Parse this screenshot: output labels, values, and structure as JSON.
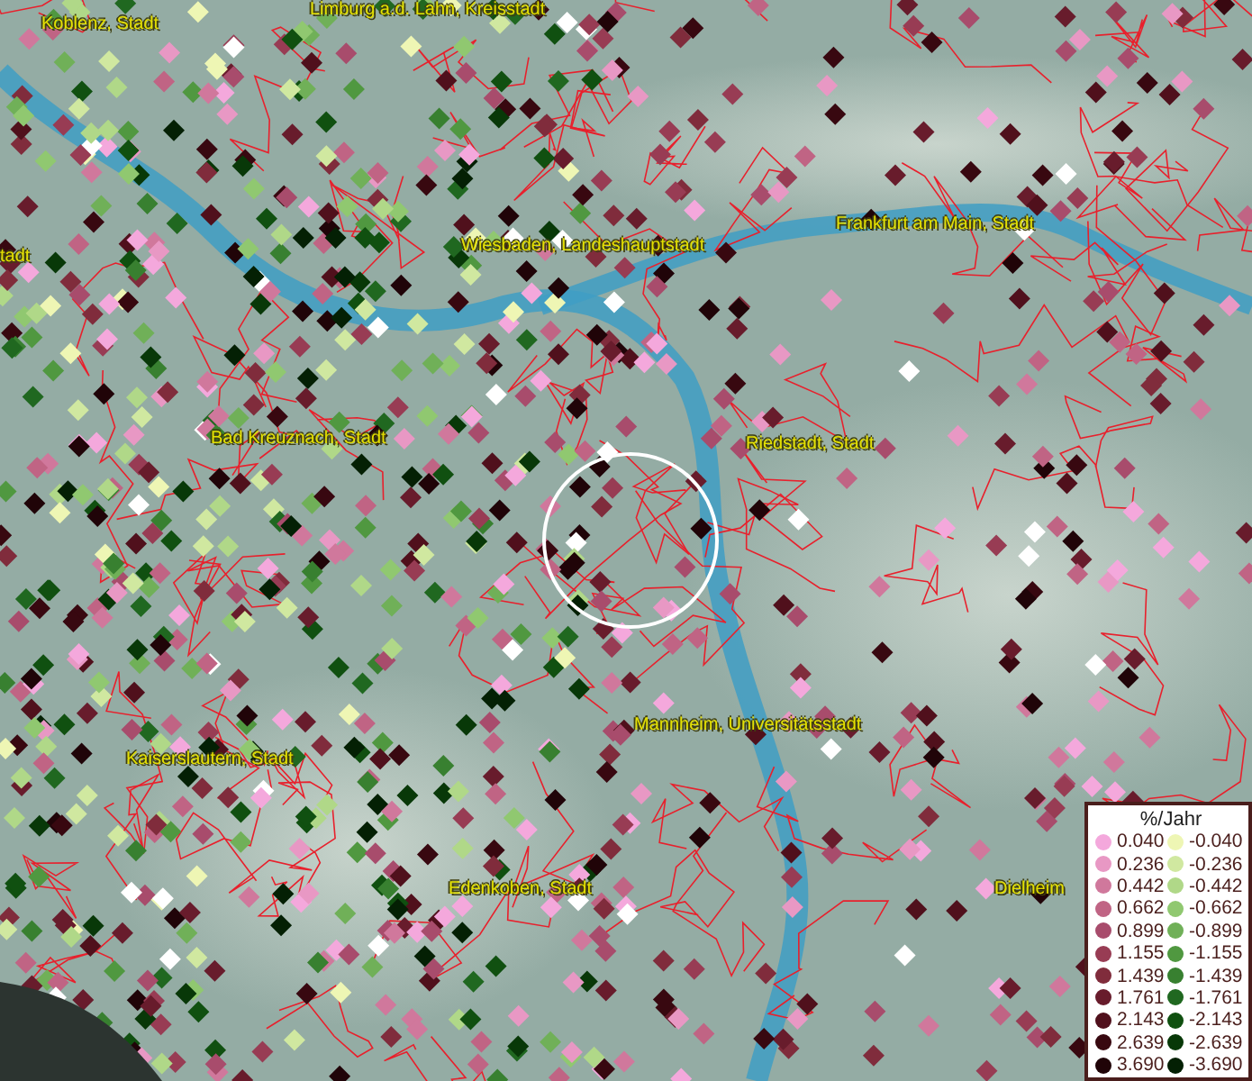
{
  "map": {
    "place_labels": [
      "Limburg a.d. Lahn, Kreisstadt",
      "Koblenz, Stadt",
      "tadt",
      "Wiesbaden, Landeshauptstadt",
      "Frankfurt am Main, Stadt",
      "Bad Kreuznach, Stadt",
      "Riedstadt, Stadt",
      "Mannheim, Universitätsstadt",
      "Kaiserslautern, Stadt",
      "Edenkoben, Stadt",
      "Dielheim"
    ]
  },
  "legend": {
    "title": "%/Jahr",
    "items": [
      {
        "label": "0.040",
        "color": "#f4a8dc"
      },
      {
        "label": "-0.040",
        "color": "#eef6b4"
      },
      {
        "label": "0.236",
        "color": "#e898c4"
      },
      {
        "label": "-0.236",
        "color": "#d0e8a0"
      },
      {
        "label": "0.442",
        "color": "#d0789c"
      },
      {
        "label": "-0.442",
        "color": "#b0d888"
      },
      {
        "label": "0.662",
        "color": "#c06484"
      },
      {
        "label": "-0.662",
        "color": "#90c870"
      },
      {
        "label": "0.899",
        "color": "#a84c6c"
      },
      {
        "label": "-0.899",
        "color": "#70b058"
      },
      {
        "label": "1.155",
        "color": "#983c54"
      },
      {
        "label": "-1.155",
        "color": "#509840"
      },
      {
        "label": "1.439",
        "color": "#802c3c"
      },
      {
        "label": "-1.439",
        "color": "#388030"
      },
      {
        "label": "1.761",
        "color": "#681c2c"
      },
      {
        "label": "-1.761",
        "color": "#206820"
      },
      {
        "label": "2.143",
        "color": "#50101c"
      },
      {
        "label": "-2.143",
        "color": "#105010"
      },
      {
        "label": "2.639",
        "color": "#380810"
      },
      {
        "label": "-2.639",
        "color": "#083808"
      },
      {
        "label": "3.690",
        "color": "#200408"
      },
      {
        "label": "-3.690",
        "color": "#042004"
      }
    ]
  }
}
